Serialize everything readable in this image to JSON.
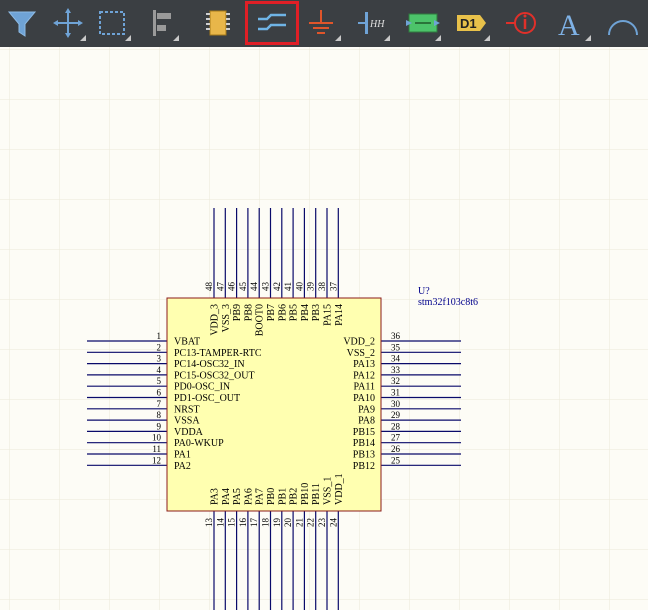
{
  "toolbar": {
    "tools": [
      {
        "name": "filter",
        "label": "",
        "active": false
      },
      {
        "name": "move",
        "label": "",
        "active": false
      },
      {
        "name": "select",
        "label": "",
        "active": false
      },
      {
        "name": "align",
        "label": "",
        "active": false
      },
      {
        "name": "place-part",
        "label": "",
        "active": false
      },
      {
        "name": "place-wire",
        "label": "",
        "active": true
      },
      {
        "name": "place-power",
        "label": "",
        "active": false
      },
      {
        "name": "place-harness",
        "label": "",
        "active": false
      },
      {
        "name": "place-sheet-symbol",
        "label": "",
        "active": false
      },
      {
        "name": "place-designator",
        "label": "D1",
        "active": false
      },
      {
        "name": "place-directive",
        "label": "",
        "active": false
      },
      {
        "name": "place-text",
        "label": "A",
        "active": false
      },
      {
        "name": "place-arc",
        "label": "",
        "active": false
      }
    ]
  },
  "component": {
    "designator": "U?",
    "comment": "stm32f103c8t6",
    "left_pins": [
      {
        "num": "1",
        "name": "VBAT"
      },
      {
        "num": "2",
        "name": "PC13-TAMPER-RTC"
      },
      {
        "num": "3",
        "name": "PC14-OSC32_IN"
      },
      {
        "num": "4",
        "name": "PC15-OSC32_OUT"
      },
      {
        "num": "5",
        "name": "PD0-OSC_IN"
      },
      {
        "num": "6",
        "name": "PD1-OSC_OUT"
      },
      {
        "num": "7",
        "name": "NRST"
      },
      {
        "num": "8",
        "name": "VSSA"
      },
      {
        "num": "9",
        "name": "VDDA"
      },
      {
        "num": "10",
        "name": "PA0-WKUP"
      },
      {
        "num": "11",
        "name": "PA1"
      },
      {
        "num": "12",
        "name": "PA2"
      }
    ],
    "right_pins": [
      {
        "num": "36",
        "name": "VDD_2"
      },
      {
        "num": "35",
        "name": "VSS_2"
      },
      {
        "num": "34",
        "name": "PA13"
      },
      {
        "num": "33",
        "name": "PA12"
      },
      {
        "num": "32",
        "name": "PA11"
      },
      {
        "num": "31",
        "name": "PA10"
      },
      {
        "num": "30",
        "name": "PA9"
      },
      {
        "num": "29",
        "name": "PA8"
      },
      {
        "num": "28",
        "name": "PB15"
      },
      {
        "num": "27",
        "name": "PB14"
      },
      {
        "num": "26",
        "name": "PB13"
      },
      {
        "num": "25",
        "name": "PB12"
      }
    ],
    "top_pins": [
      {
        "num": "48",
        "name": "VDD_3"
      },
      {
        "num": "47",
        "name": "VSS_3"
      },
      {
        "num": "46",
        "name": "PB9"
      },
      {
        "num": "45",
        "name": "PB8"
      },
      {
        "num": "44",
        "name": "BOOT0"
      },
      {
        "num": "43",
        "name": "PB7"
      },
      {
        "num": "42",
        "name": "PB6"
      },
      {
        "num": "41",
        "name": "PB5"
      },
      {
        "num": "40",
        "name": "PB4"
      },
      {
        "num": "39",
        "name": "PB3"
      },
      {
        "num": "38",
        "name": "PA15"
      },
      {
        "num": "37",
        "name": "PA14"
      }
    ],
    "bottom_pins": [
      {
        "num": "13",
        "name": "PA3"
      },
      {
        "num": "14",
        "name": "PA4"
      },
      {
        "num": "15",
        "name": "PA5"
      },
      {
        "num": "16",
        "name": "PA6"
      },
      {
        "num": "17",
        "name": "PA7"
      },
      {
        "num": "18",
        "name": "PB0"
      },
      {
        "num": "19",
        "name": "PB1"
      },
      {
        "num": "20",
        "name": "PB2"
      },
      {
        "num": "21",
        "name": "PB10"
      },
      {
        "num": "22",
        "name": "PB11"
      },
      {
        "num": "23",
        "name": "VSS_1"
      },
      {
        "num": "24",
        "name": "VDD_1"
      }
    ]
  },
  "colors": {
    "toolbar_bg": "#3b3f43",
    "canvas_bg": "#fdfcf6",
    "grid": "#ece9d8",
    "body_fill": "#ffffb0",
    "body_stroke": "#8b1a1a",
    "pin_line": "#0a0a6a",
    "label_text": "#000000",
    "designator_text": "#00008b",
    "active_outline": "#e01f26"
  }
}
